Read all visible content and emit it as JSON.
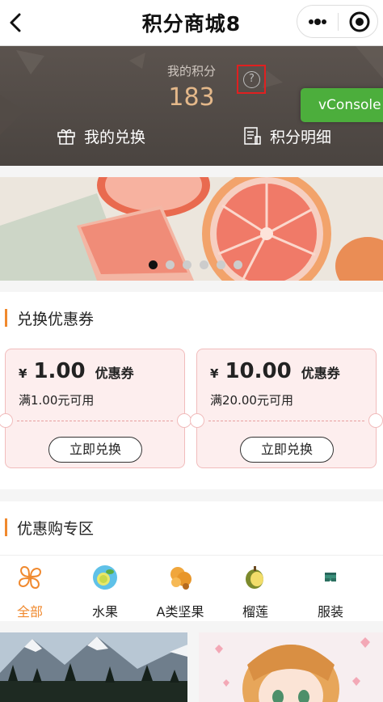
{
  "navbar": {
    "title": "积分商城8",
    "back_icon": "back-arrow-icon",
    "more_icon": "more-dots-icon",
    "close_icon": "close-target-icon"
  },
  "points": {
    "label": "我的积分",
    "value": "183",
    "help_icon": "question-circle-icon",
    "vconsole_label": "vConsole",
    "my_exchange_label": "我的兑换",
    "points_detail_label": "积分明细",
    "value_color": "#e4b88a"
  },
  "banner": {
    "slide_count": 6,
    "active_slide": 1
  },
  "coupon_section": {
    "title": "兑换优惠券",
    "coupons": [
      {
        "currency": "¥",
        "amount": "1.00",
        "tag": "优惠券",
        "condition": "满1.00元可用",
        "button": "立即兑换"
      },
      {
        "currency": "¥",
        "amount": "10.00",
        "tag": "优惠券",
        "condition": "满20.00元可用",
        "button": "立即兑换"
      }
    ]
  },
  "discount_section": {
    "title": "优惠购专区",
    "categories": [
      {
        "label": "全部",
        "icon": "all-grid-icon",
        "active": true
      },
      {
        "label": "水果",
        "icon": "fruit-icon",
        "active": false
      },
      {
        "label": "A类坚果",
        "icon": "nut-icon",
        "active": false
      },
      {
        "label": "榴莲",
        "icon": "durian-icon",
        "active": false
      },
      {
        "label": "服装",
        "icon": "clothing-icon",
        "active": false
      }
    ]
  },
  "colors": {
    "accent": "#f0892e",
    "vconsole": "#4cae3c",
    "coupon_bg": "#fdeeee",
    "highlight_box": "#e02020"
  }
}
